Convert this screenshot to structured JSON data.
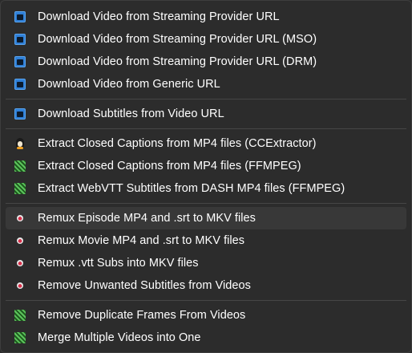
{
  "menu": {
    "groups": [
      {
        "items": [
          {
            "label": "Download Video from Streaming Provider URL",
            "icon": "streaming-app-icon"
          },
          {
            "label": "Download Video from Streaming Provider URL (MSO)",
            "icon": "streaming-app-icon"
          },
          {
            "label": "Download Video from Streaming Provider URL (DRM)",
            "icon": "streaming-app-icon"
          },
          {
            "label": "Download Video from Generic URL",
            "icon": "streaming-app-icon"
          }
        ]
      },
      {
        "items": [
          {
            "label": "Download Subtitles from Video URL",
            "icon": "streaming-app-icon"
          }
        ]
      },
      {
        "items": [
          {
            "label": "Extract Closed Captions from MP4 files (CCExtractor)",
            "icon": "ccextractor-icon"
          },
          {
            "label": "Extract Closed Captions from MP4 files (FFMPEG)",
            "icon": "ffmpeg-icon"
          },
          {
            "label": "Extract WebVTT Subtitles from DASH MP4 files (FFMPEG)",
            "icon": "ffmpeg-icon"
          }
        ]
      },
      {
        "items": [
          {
            "label": "Remux Episode MP4 and .srt to MKV files",
            "icon": "mkvtoolnix-icon",
            "hovered": true
          },
          {
            "label": "Remux Movie MP4 and .srt to MKV files",
            "icon": "mkvtoolnix-icon"
          },
          {
            "label": "Remux .vtt Subs into MKV files",
            "icon": "mkvtoolnix-icon"
          },
          {
            "label": "Remove Unwanted Subtitles from Videos",
            "icon": "mkvtoolnix-icon"
          }
        ]
      },
      {
        "items": [
          {
            "label": "Remove Duplicate Frames From Videos",
            "icon": "ffmpeg-icon"
          },
          {
            "label": "Merge Multiple Videos into One",
            "icon": "ffmpeg-icon"
          }
        ]
      }
    ]
  },
  "colors": {
    "menu_background": "#2c2c2c",
    "hover_background": "#383838",
    "separator": "#464646",
    "text": "#ffffff"
  }
}
